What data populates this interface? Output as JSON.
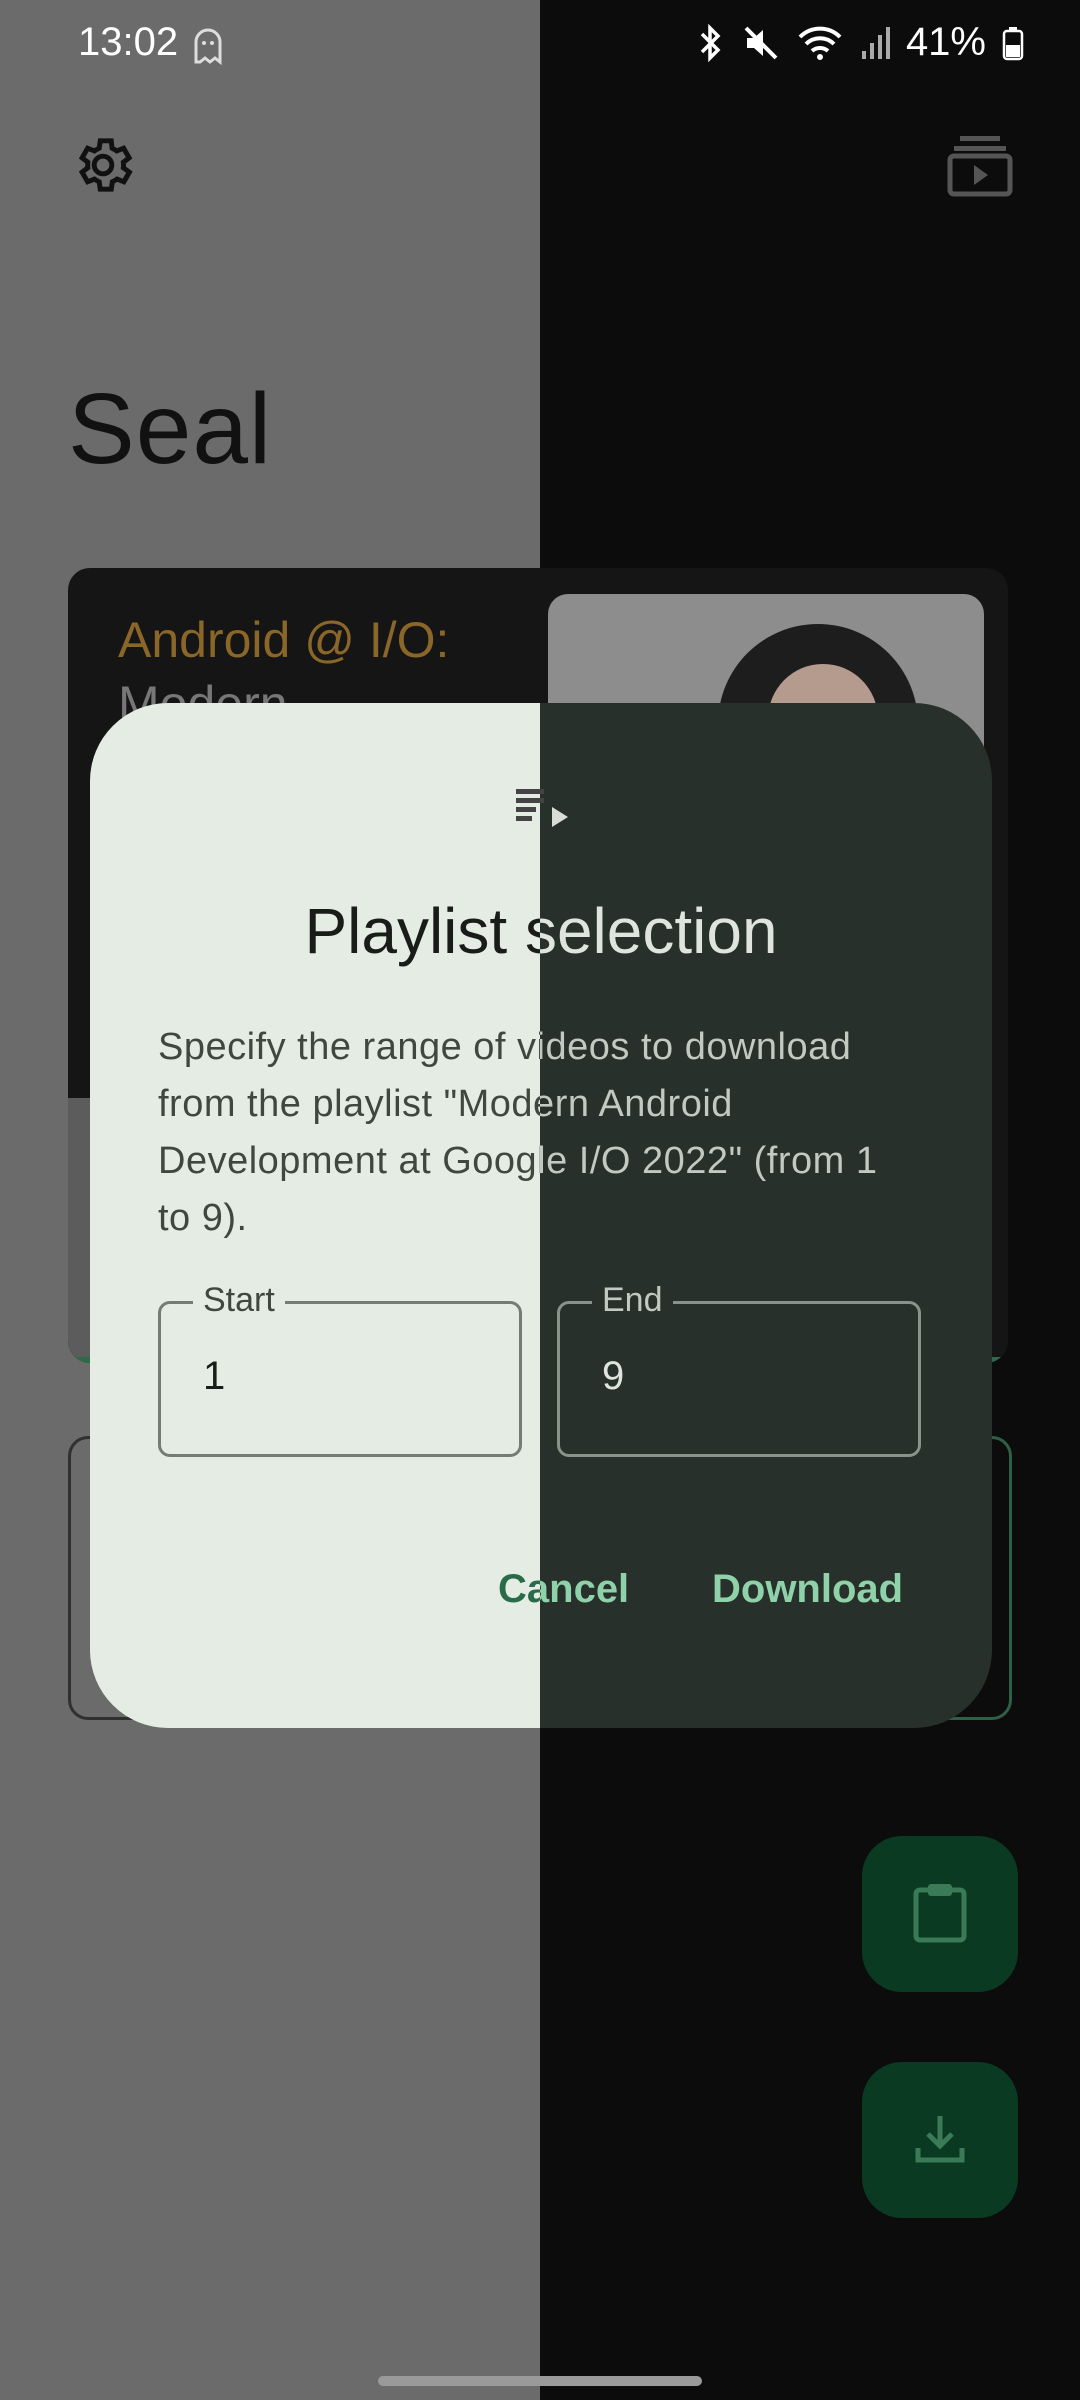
{
  "status_bar": {
    "time": "13:02",
    "battery": "41%"
  },
  "app": {
    "title": "Seal"
  },
  "video_card": {
    "title_line1": "Android @ I/O:",
    "title_line2": "Modern"
  },
  "dialog": {
    "title": "Playlist selection",
    "body": "Specify the range of videos to download from the playlist \"Modern Android Development at Google I/O 2022\" (from 1 to 9).",
    "start_label": "Start",
    "start_value": "1",
    "end_label": "End",
    "end_value": "9",
    "cancel_label": "Cancel",
    "download_label": "Download"
  },
  "colors": {
    "accent": "#8fd1a8",
    "dialog_light": "#e4ece4",
    "dialog_dark": "#27302a"
  }
}
